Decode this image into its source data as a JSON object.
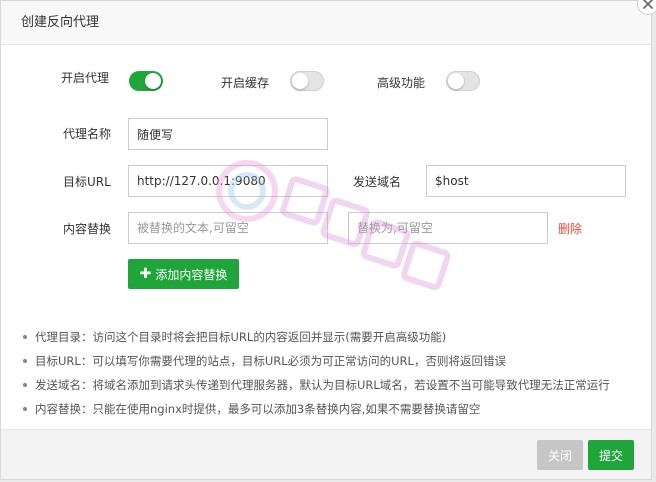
{
  "dialog": {
    "title": "创建反向代理"
  },
  "toggles": {
    "proxy": {
      "label": "开启代理",
      "on": true
    },
    "cache": {
      "label": "开启缓存",
      "on": false
    },
    "advanced": {
      "label": "高级功能",
      "on": false
    }
  },
  "fields": {
    "proxy_name": {
      "label": "代理名称",
      "value": "随便写"
    },
    "target_url": {
      "label": "目标URL",
      "value": "http://127.0.0.1:9080"
    },
    "send_domain": {
      "label": "发送域名",
      "value": "$host"
    },
    "content_replace": {
      "label": "内容替换",
      "from_placeholder": "被替换的文本,可留空",
      "to_placeholder": "替换为,可留空",
      "delete_label": "删除"
    }
  },
  "add_replace_button": "添加内容替换",
  "notes": [
    "代理目录：访问这个目录时将会把目标URL的内容返回并显示(需要开启高级功能)",
    "目标URL：可以填写你需要代理的站点，目标URL必须为可正常访问的URL，否则将返回错误",
    "发送域名：将域名添加到请求头传递到代理服务器，默认为目标URL域名，若设置不当可能导致代理无法正常运行",
    "内容替换：只能在使用nginx时提供，最多可以添加3条替换内容,如果不需要替换请留空"
  ],
  "footer": {
    "close_label": "关闭",
    "submit_label": "提交"
  },
  "colors": {
    "accent": "#20a53a",
    "danger": "#e74c3c",
    "disabled": "#c6c6c6"
  }
}
